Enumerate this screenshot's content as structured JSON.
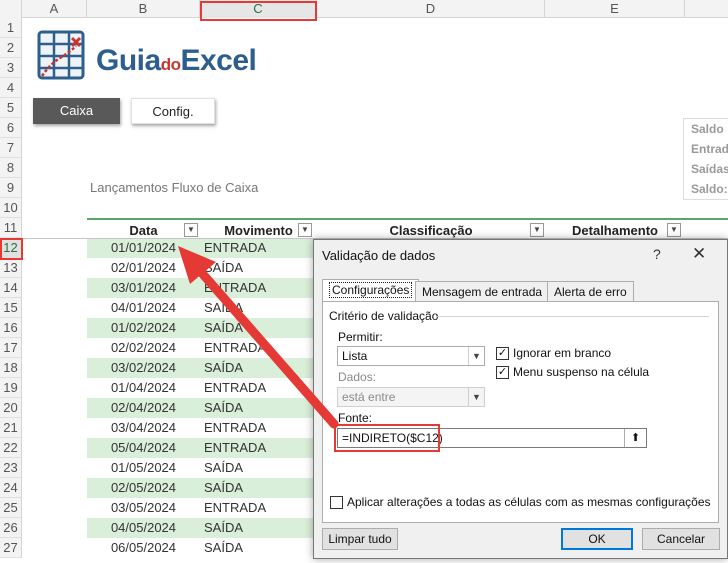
{
  "columns": [
    "A",
    "B",
    "C",
    "D",
    "E"
  ],
  "selected_column": "C",
  "rows": [
    "1",
    "2",
    "3",
    "4",
    "5",
    "6",
    "7",
    "8",
    "9",
    "10",
    "11",
    "12",
    "13",
    "14",
    "15",
    "16",
    "17",
    "18",
    "19",
    "20",
    "21",
    "22",
    "23",
    "24",
    "25",
    "26",
    "27"
  ],
  "active_row": "12",
  "logo": {
    "main": "Guia",
    "middle": "do",
    "end": "Excel"
  },
  "sheet_buttons": {
    "caixa": "Caixa",
    "config": "Config."
  },
  "saldo_panel": [
    "Saldo",
    "Entrad",
    "Saídas",
    "Saldo:"
  ],
  "section_title": "Lançamentos Fluxo de Caixa",
  "table": {
    "headers": [
      "Data",
      "Movimento",
      "Classificação",
      "Detalhamento"
    ],
    "rows": [
      {
        "date": "01/01/2024",
        "mov": "ENTRADA"
      },
      {
        "date": "02/01/2024",
        "mov": "SAÍDA"
      },
      {
        "date": "03/01/2024",
        "mov": "ENTRADA"
      },
      {
        "date": "04/01/2024",
        "mov": "SAÍDA"
      },
      {
        "date": "01/02/2024",
        "mov": "SAÍDA"
      },
      {
        "date": "02/02/2024",
        "mov": "ENTRADA"
      },
      {
        "date": "03/02/2024",
        "mov": "SAÍDA"
      },
      {
        "date": "01/04/2024",
        "mov": "ENTRADA"
      },
      {
        "date": "02/04/2024",
        "mov": "SAÍDA"
      },
      {
        "date": "03/04/2024",
        "mov": "ENTRADA"
      },
      {
        "date": "05/04/2024",
        "mov": "ENTRADA"
      },
      {
        "date": "01/05/2024",
        "mov": "SAÍDA"
      },
      {
        "date": "02/05/2024",
        "mov": "SAÍDA"
      },
      {
        "date": "03/05/2024",
        "mov": "ENTRADA"
      },
      {
        "date": "04/05/2024",
        "mov": "SAÍDA"
      },
      {
        "date": "06/05/2024",
        "mov": "SAÍDA"
      }
    ]
  },
  "dialog": {
    "title": "Validação de dados",
    "help": "?",
    "close": "✕",
    "tabs": [
      "Configurações",
      "Mensagem de entrada",
      "Alerta de erro"
    ],
    "criteria_label": "Critério de validação",
    "allow_label": "Permitir:",
    "allow_value": "Lista",
    "data_label": "Dados:",
    "data_value": "está entre",
    "ignore_blank": "Ignorar em branco",
    "in_cell_dropdown": "Menu suspenso na célula",
    "source_label": "Fonte:",
    "source_value": "=INDIRETO($C12)",
    "apply_all": "Aplicar alterações a todas as células com as mesmas configurações",
    "clear_all": "Limpar tudo",
    "ok": "OK",
    "cancel": "Cancelar"
  },
  "colors": {
    "accent_red": "#e53935",
    "table_green": "#d9efd9",
    "excel_green": "#217346",
    "logo_blue": "#2e5e8e"
  }
}
